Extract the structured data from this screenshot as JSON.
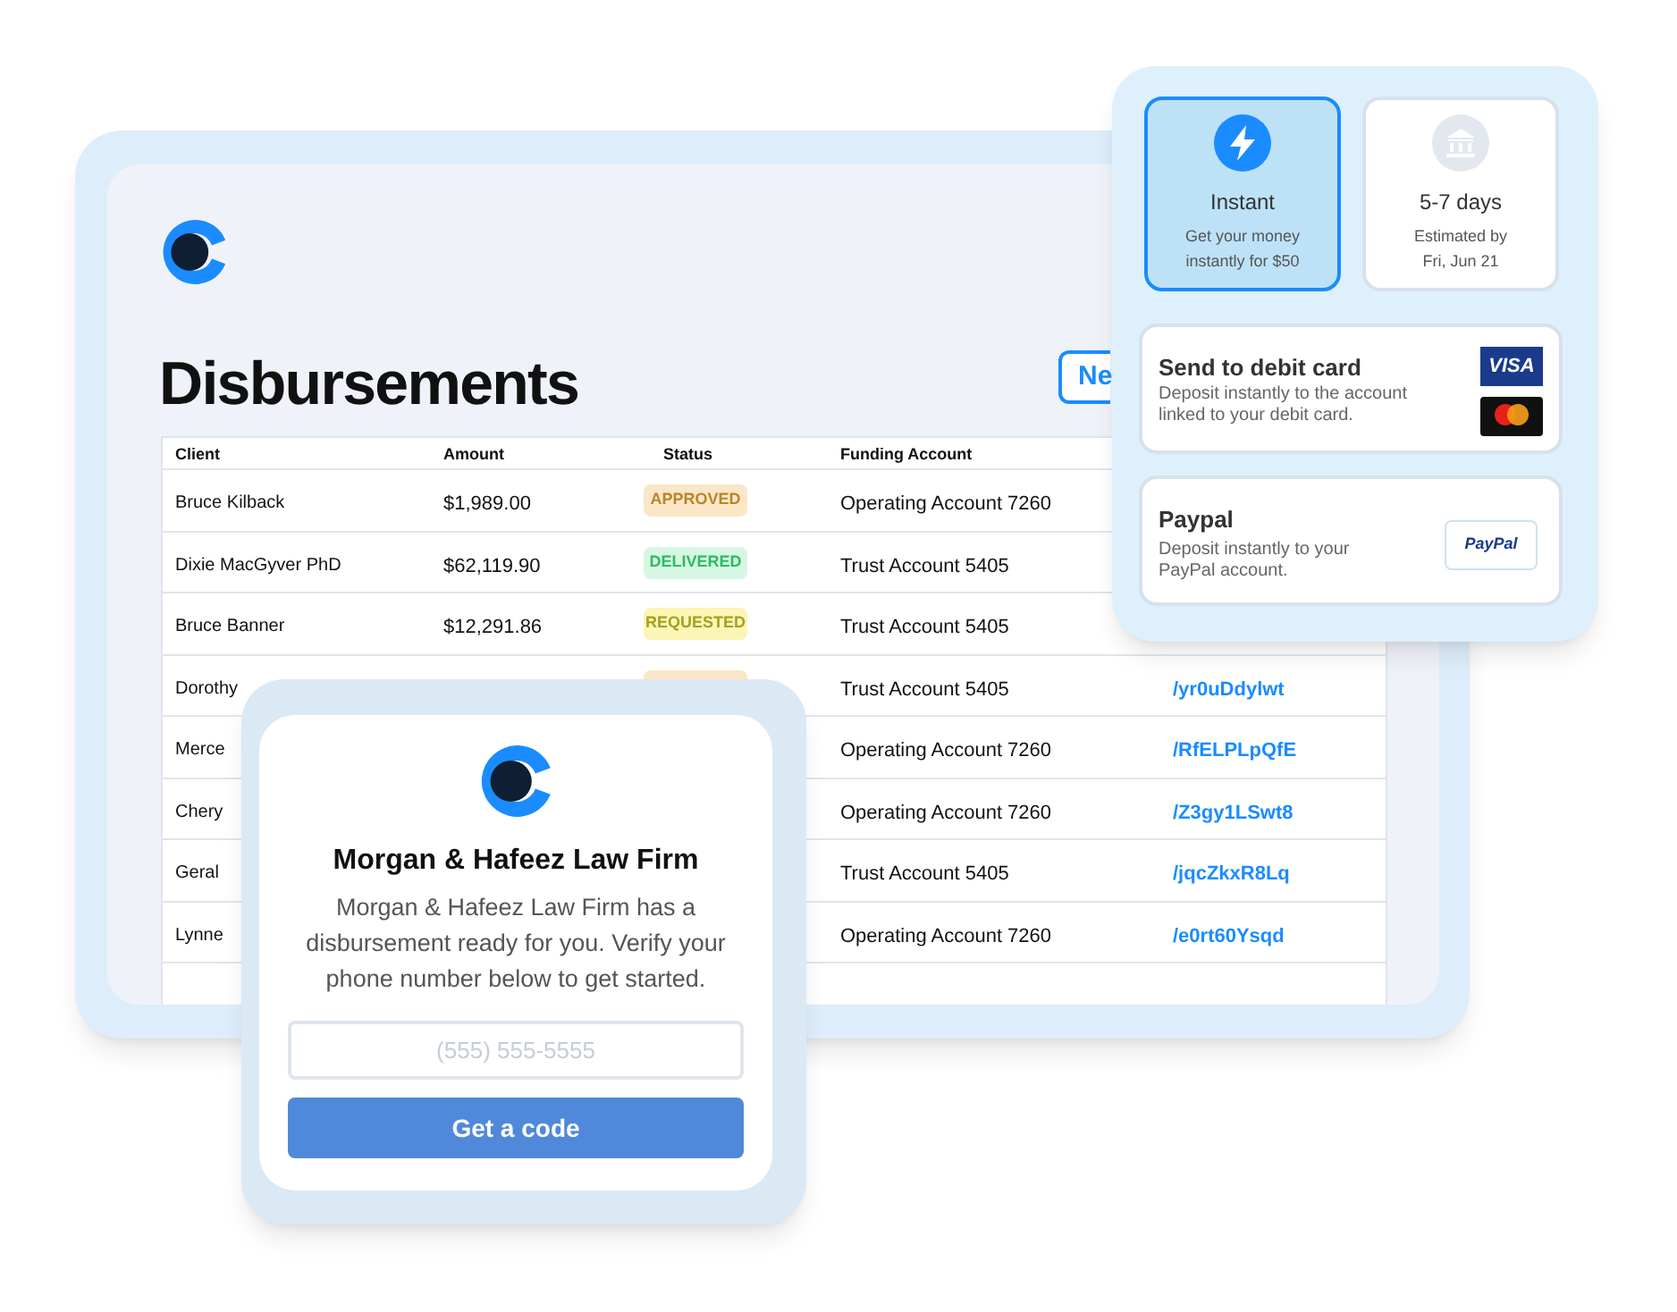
{
  "dashboard": {
    "title": "Disbursements",
    "new_button": "Ne"
  },
  "table": {
    "columns": [
      "Client",
      "Amount",
      "Status",
      "Funding Account"
    ],
    "rows": [
      {
        "client": "Bruce Kilback",
        "amount": "$1,989.00",
        "status": {
          "kind": "approved",
          "label": "APPROVED"
        },
        "account": "Operating Account 7260"
      },
      {
        "client": "Dixie MacGyver PhD",
        "amount": "$62,119.90",
        "status": {
          "kind": "delivered",
          "label": "DELIVERED"
        },
        "account": "Trust Account 5405"
      },
      {
        "client": "Bruce Banner",
        "amount": "$12,291.86",
        "status": {
          "kind": "requested",
          "label": "REQUESTED"
        },
        "account": "Trust Account 5405"
      },
      {
        "client": "Dorothy",
        "status": {
          "kind": "approved"
        },
        "account": "Trust Account 5405",
        "link": "/yr0uDdylwt"
      },
      {
        "client": "Merce",
        "account": "Operating Account 7260",
        "link": "/RfELPLpQfE"
      },
      {
        "client": "Chery",
        "account": "Operating Account 7260",
        "link": "/Z3gy1LSwt8"
      },
      {
        "client": "Geral",
        "account": "Trust Account 5405",
        "link": "/jqcZkxR8Lq"
      },
      {
        "client": "Lynne",
        "account": "Operating Account 7260",
        "link": "/e0rt60Ysqd"
      }
    ]
  },
  "speed_options": [
    {
      "kind": "instant",
      "title": "Instant",
      "description": "Get your money\ninstantly for $50",
      "selected": true
    },
    {
      "kind": "bank",
      "title": "5-7 days",
      "description": "Estimated by\nFri, Jun 21",
      "selected": false
    }
  ],
  "payout_methods": [
    {
      "kind": "debit",
      "title": "Send to debit card",
      "description": "Deposit instantly to the account\nlinked to your debit card.",
      "badge": "VISA"
    },
    {
      "kind": "paypal",
      "title": "Paypal",
      "description": "Deposit instantly to your\nPayPal account.",
      "badge": "PayPal"
    }
  ],
  "verify_card": {
    "title": "Morgan & Hafeez Law Firm",
    "message": "Morgan & Hafeez Law Firm has a disbursement ready for you. Verify your phone number below to get started.",
    "phone_placeholder": "(555) 555-5555",
    "button": "Get a code"
  }
}
